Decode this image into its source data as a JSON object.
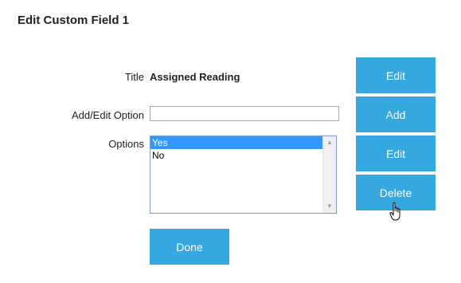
{
  "dialog": {
    "title": "Edit Custom Field 1"
  },
  "form": {
    "title_label": "Title",
    "title_value": "Assigned Reading",
    "add_edit_label": "Add/Edit Option",
    "add_edit_value": "",
    "options_label": "Options",
    "options": [
      {
        "label": "Yes",
        "selected": true
      },
      {
        "label": "No",
        "selected": false
      }
    ]
  },
  "buttons": {
    "edit_title": "Edit",
    "add": "Add",
    "edit_option": "Edit",
    "delete": "Delete",
    "done": "Done"
  },
  "colors": {
    "button_bg": "#35a8e0",
    "selection": "#3399ff"
  },
  "icons": {
    "cursor": "hand-pointer-icon",
    "scroll_up": "scroll-up-arrow-icon",
    "scroll_down": "scroll-down-arrow-icon"
  }
}
